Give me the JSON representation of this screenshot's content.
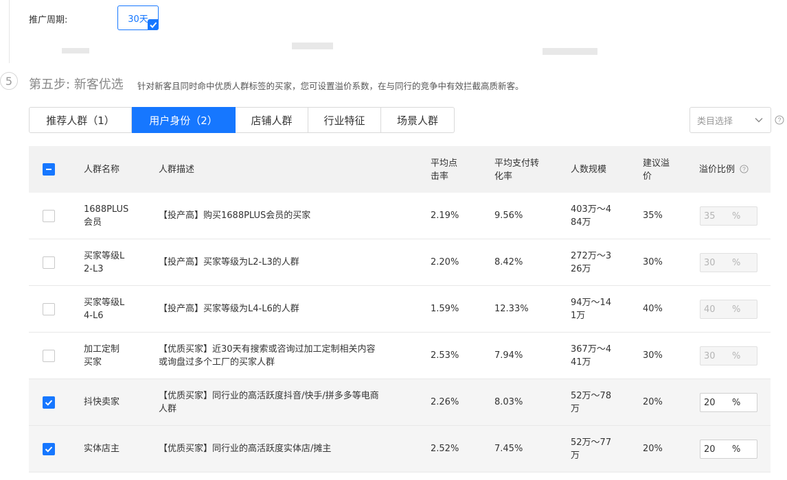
{
  "period": {
    "label": "推广周期:",
    "option": "30天"
  },
  "step": {
    "number": "5",
    "prefix": "第五步:",
    "name": "新客优选",
    "desc": "针对新客且同时命中优质人群标签的买家，您可设置溢价系数，在与同行的竞争中有效拦截高质新客。"
  },
  "tabs": [
    "推荐人群（1）",
    "用户身份（2）",
    "店铺人群",
    "行业特征",
    "场景人群"
  ],
  "active_tab": 1,
  "category_select": {
    "placeholder": "类目选择",
    "icon": "chevron-down-icon"
  },
  "columns": {
    "name": "人群名称",
    "desc": "人群描述",
    "ctr": [
      "平均点",
      "击率"
    ],
    "cvr": [
      "平均支付转",
      "化率"
    ],
    "size": "人数规模",
    "suggest": [
      "建议溢",
      "价"
    ],
    "ratio": "溢价比例"
  },
  "colors": {
    "accent": "#1677ff",
    "header_bg": "#f2f2f2"
  },
  "rows": [
    {
      "name": [
        "1688PLUS",
        "会员"
      ],
      "desc": [
        "【投产高】购买1688PLUS会员的买家"
      ],
      "ctr": "2.19%",
      "cvr": "9.56%",
      "size": [
        "403万～4",
        "84万"
      ],
      "suggest": "35%",
      "ratio": "35",
      "unit": "%",
      "checked": false
    },
    {
      "name": [
        "买家等级L",
        "2-L3"
      ],
      "desc": [
        "【投产高】买家等级为L2-L3的人群"
      ],
      "ctr": "2.20%",
      "cvr": "8.42%",
      "size": [
        "272万～3",
        "26万"
      ],
      "suggest": "30%",
      "ratio": "30",
      "unit": "%",
      "checked": false
    },
    {
      "name": [
        "买家等级L",
        "4-L6"
      ],
      "desc": [
        "【投产高】买家等级为L4-L6的人群"
      ],
      "ctr": "1.59%",
      "cvr": "12.33%",
      "size": [
        "94万～14",
        "1万"
      ],
      "suggest": "40%",
      "ratio": "40",
      "unit": "%",
      "checked": false
    },
    {
      "name": [
        "加工定制",
        "买家"
      ],
      "desc": [
        "【优质买家】近30天有搜索或咨询过加工定制相关内容",
        "或询盘过多个工厂的买家人群"
      ],
      "ctr": "2.53%",
      "cvr": "7.94%",
      "size": [
        "367万～4",
        "41万"
      ],
      "suggest": "30%",
      "ratio": "30",
      "unit": "%",
      "checked": false
    },
    {
      "name": [
        "抖快卖家"
      ],
      "desc": [
        "【优质买家】同行业的高活跃度抖音/快手/拼多多等电商",
        "人群"
      ],
      "ctr": "2.26%",
      "cvr": "8.03%",
      "size": [
        "52万～78",
        "万"
      ],
      "suggest": "20%",
      "ratio": "20",
      "unit": "%",
      "checked": true
    },
    {
      "name": [
        "实体店主"
      ],
      "desc": [
        "【优质买家】同行业的高活跃度实体店/摊主"
      ],
      "ctr": "2.52%",
      "cvr": "7.45%",
      "size": [
        "52万～77",
        "万"
      ],
      "suggest": "20%",
      "ratio": "20",
      "unit": "%",
      "checked": true
    }
  ]
}
